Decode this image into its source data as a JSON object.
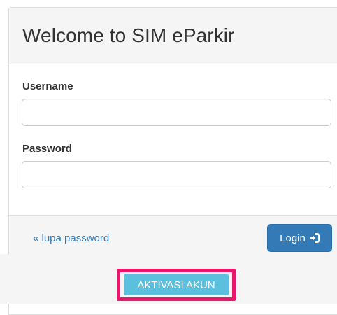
{
  "panel": {
    "title": "Welcome to SIM eParkir"
  },
  "form": {
    "username_label": "Username",
    "username_value": "",
    "password_label": "Password",
    "password_value": ""
  },
  "footer": {
    "forgot_link": "« lupa password",
    "login_label": "Login",
    "login_icon": "sign-in-icon"
  },
  "activation": {
    "button_label": "AKTIVASI AKUN"
  },
  "colors": {
    "primary": "#337ab7",
    "info": "#5bc0de",
    "highlight": "#e8176b",
    "panel_bg": "#f5f5f5"
  }
}
